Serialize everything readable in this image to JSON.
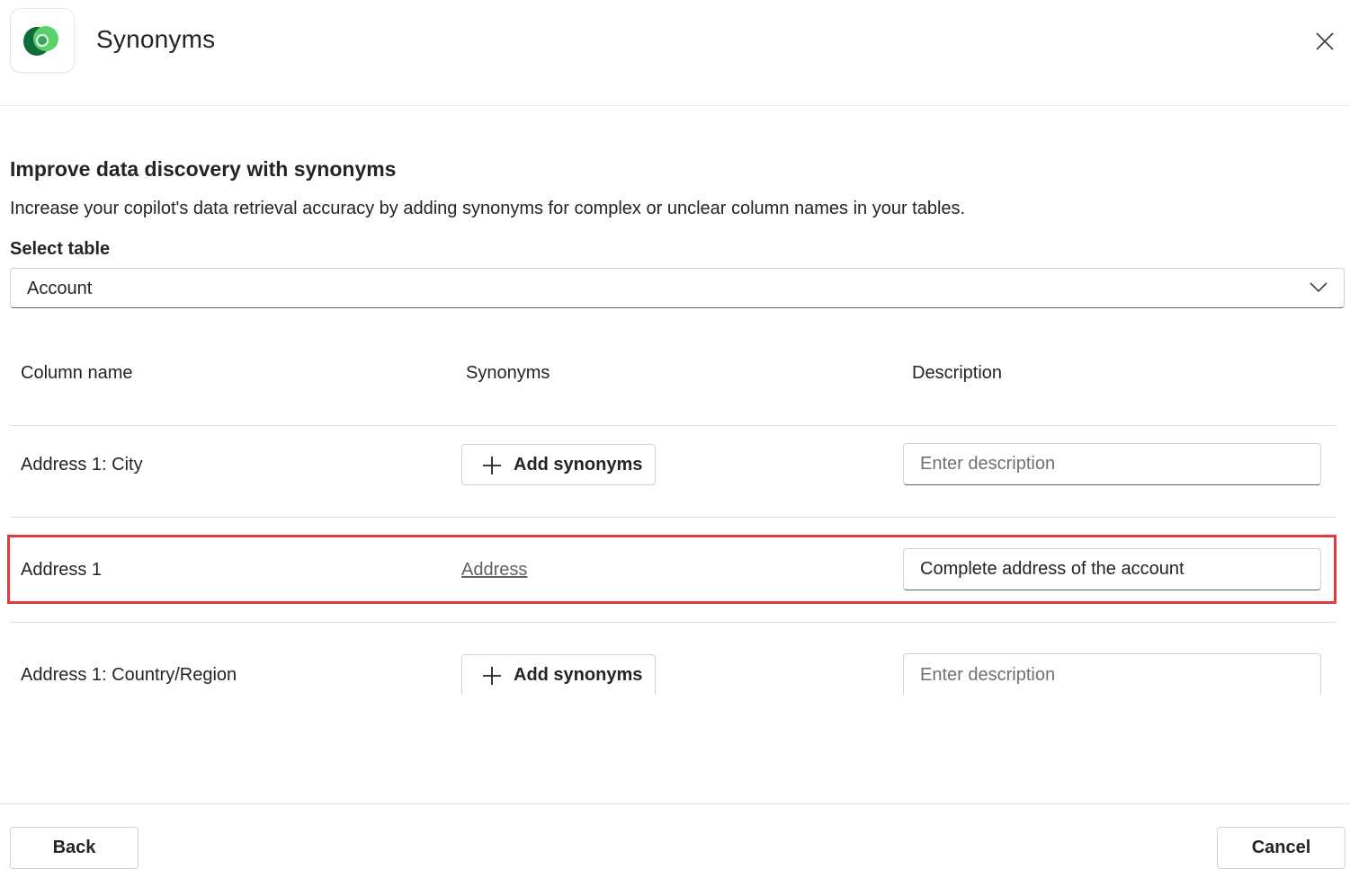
{
  "dialog": {
    "title": "Synonyms",
    "app_icon": "dataverse-logo",
    "close_icon": "close-icon"
  },
  "content": {
    "heading": "Improve data discovery with synonyms",
    "description": "Increase your copilot's data retrieval accuracy by adding synonyms for complex or unclear column names in your tables.",
    "select_label": "Select table",
    "selected_table": "Account"
  },
  "table": {
    "headers": [
      "Column name",
      "Synonyms",
      "Description"
    ],
    "rows": [
      {
        "column_name": "Address 1: City",
        "synonyms": "",
        "add_synonyms_label": "Add synonyms",
        "description": "",
        "description_placeholder": "Enter description"
      },
      {
        "column_name": "Address 1",
        "synonyms": "Address",
        "add_synonyms_label": "",
        "description": "Complete address of the account",
        "description_placeholder": "Enter description",
        "highlighted": true
      },
      {
        "column_name": "Address 1: Country/Region",
        "synonyms": "",
        "add_synonyms_label": "Add synonyms",
        "description": "",
        "description_placeholder": "Enter description"
      }
    ]
  },
  "footer": {
    "back_label": "Back",
    "cancel_label": "Cancel"
  },
  "colors": {
    "highlight": "#e03a3e",
    "text": "#242424",
    "logo_dark": "#0f6b3a",
    "logo_light": "#5cd06a"
  }
}
